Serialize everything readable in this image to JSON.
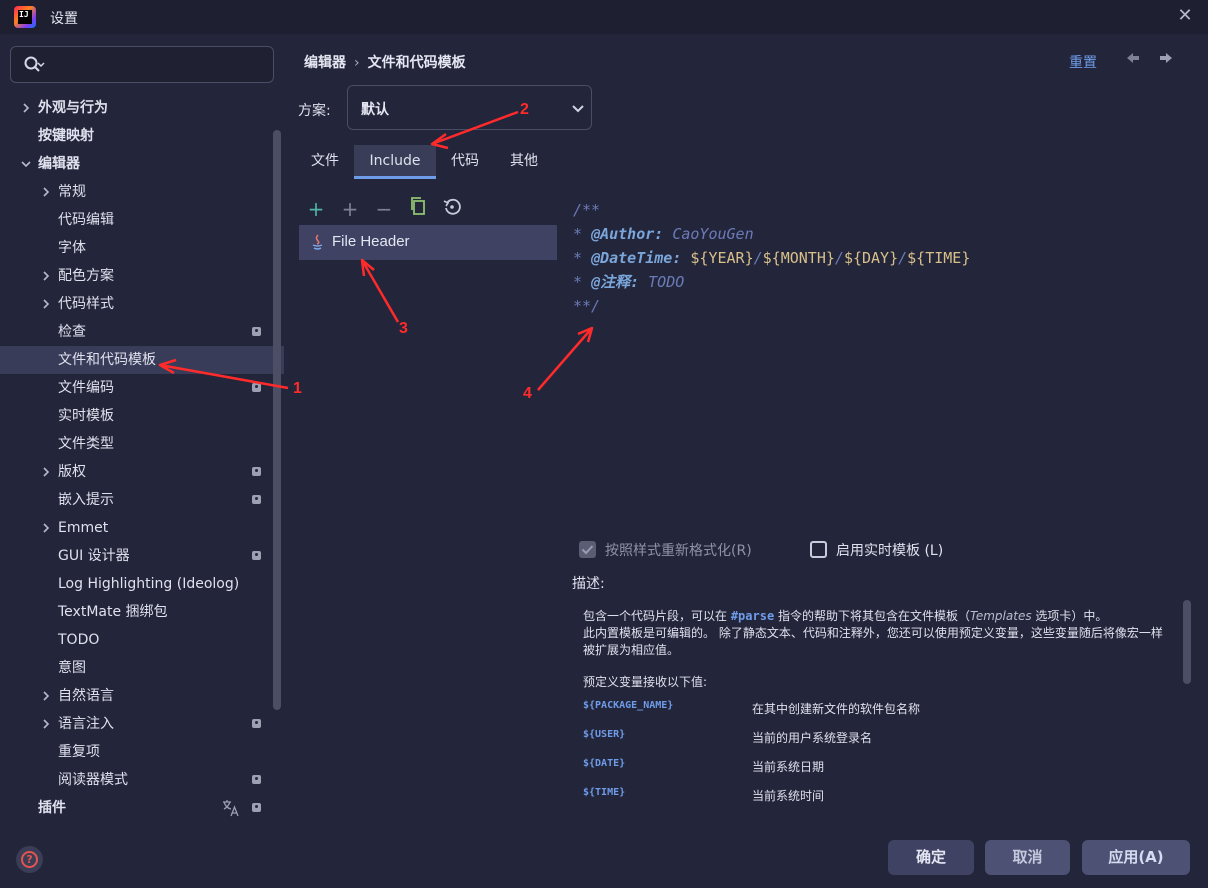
{
  "window": {
    "title": "设置",
    "close_glyph": "✕",
    "logo_text": "IJ"
  },
  "sidebar": {
    "search_placeholder": "",
    "items": [
      {
        "label": "外观与行为",
        "chevron": true,
        "bold": true,
        "level": 0
      },
      {
        "label": "按键映射",
        "chevron": false,
        "bold": true,
        "level": 0
      },
      {
        "label": "编辑器",
        "chevron": "open",
        "bold": true,
        "level": 0
      },
      {
        "label": "常规",
        "chevron": true,
        "level": 1
      },
      {
        "label": "代码编辑",
        "level": 1
      },
      {
        "label": "字体",
        "level": 1
      },
      {
        "label": "配色方案",
        "chevron": true,
        "level": 1
      },
      {
        "label": "代码样式",
        "chevron": true,
        "level": 1
      },
      {
        "label": "检查",
        "level": 1,
        "badge": true
      },
      {
        "label": "文件和代码模板",
        "level": 1,
        "selected": true
      },
      {
        "label": "文件编码",
        "level": 1,
        "badge": true
      },
      {
        "label": "实时模板",
        "level": 1
      },
      {
        "label": "文件类型",
        "level": 1
      },
      {
        "label": "版权",
        "chevron": true,
        "level": 1,
        "badge": true
      },
      {
        "label": "嵌入提示",
        "level": 1,
        "badge": true
      },
      {
        "label": "Emmet",
        "chevron": true,
        "level": 1
      },
      {
        "label": "GUI 设计器",
        "level": 1,
        "badge": true
      },
      {
        "label": "Log Highlighting (Ideolog)",
        "level": 1
      },
      {
        "label": "TextMate 捆绑包",
        "level": 1
      },
      {
        "label": "TODO",
        "level": 1
      },
      {
        "label": "意图",
        "level": 1
      },
      {
        "label": "自然语言",
        "chevron": true,
        "level": 1
      },
      {
        "label": "语言注入",
        "chevron": true,
        "level": 1,
        "badge": true
      },
      {
        "label": "重复项",
        "level": 1
      },
      {
        "label": "阅读器模式",
        "level": 1,
        "badge": true
      },
      {
        "label": "插件",
        "bold": true,
        "level": 0,
        "badge": true,
        "translate": true
      }
    ]
  },
  "header": {
    "breadcrumb": [
      "编辑器",
      "文件和代码模板"
    ],
    "breadcrumb_sep": "›",
    "reset": "重置",
    "back_glyph": "🡐",
    "forward_glyph": "🡒"
  },
  "scheme": {
    "label": "方案:",
    "value": "默认",
    "chevron": "⌵"
  },
  "tabs": [
    {
      "label": "文件",
      "active": false
    },
    {
      "label": "Include",
      "active": true
    },
    {
      "label": "代码",
      "active": false
    },
    {
      "label": "其他",
      "active": false
    }
  ],
  "toolbar": {
    "add": "+",
    "add_child": "+",
    "remove": "−",
    "copy": "⧉",
    "reset": "⟲"
  },
  "templates": [
    {
      "name": "File Header",
      "icon": "java-icon"
    }
  ],
  "editor": {
    "line1": "/**",
    "line2_prefix": "* ",
    "line2_tag": "@Author:",
    "line2_val": " CaoYouGen",
    "line3_prefix": "* ",
    "line3_tag": "@DateTime:",
    "line3_sp": " ",
    "v_year": "${YEAR}",
    "v_month": "${MONTH}",
    "v_day": "${DAY}",
    "v_time": "${TIME}",
    "slash": "/",
    "line4_prefix": "* ",
    "line4_tag": "@注释:",
    "line4_val": " TODO",
    "line5": "**/"
  },
  "options": {
    "reformat": {
      "label": "按照样式重新格式化(R)",
      "checked": true,
      "disabled": true
    },
    "live_templates": {
      "label": "启用实时模板 (L)",
      "checked": false
    }
  },
  "description": {
    "title": "描述:",
    "p1_a": "包含一个代码片段，可以在 ",
    "p1_code": "#parse",
    "p1_b": " 指令的帮助下将其包含在文件模板（",
    "p1_it": "Templates",
    "p1_c": " 选项卡）中。",
    "p2": "此内置模板是可编辑的。 除了静态文本、代码和注释外，您还可以使用预定义变量，这些变量随后将像宏一样",
    "p3": "被扩展为相应值。",
    "p4": "预定义变量接收以下值:",
    "vars": [
      {
        "key": "${PACKAGE_NAME}",
        "value": "在其中创建新文件的软件包名称"
      },
      {
        "key": "${USER}",
        "value": "当前的用户系统登录名"
      },
      {
        "key": "${DATE}",
        "value": "当前系统日期"
      },
      {
        "key": "${TIME}",
        "value": "当前系统时间"
      }
    ]
  },
  "footer": {
    "ok": "确定",
    "cancel": "取消",
    "apply": "应用(A)",
    "help_glyph": "?"
  },
  "annotations": [
    "1",
    "2",
    "3",
    "4"
  ],
  "colors": {
    "accent": "#6f9ce8",
    "selection": "#393c58",
    "annotation": "#ff2b2b",
    "background": "#23253a"
  }
}
